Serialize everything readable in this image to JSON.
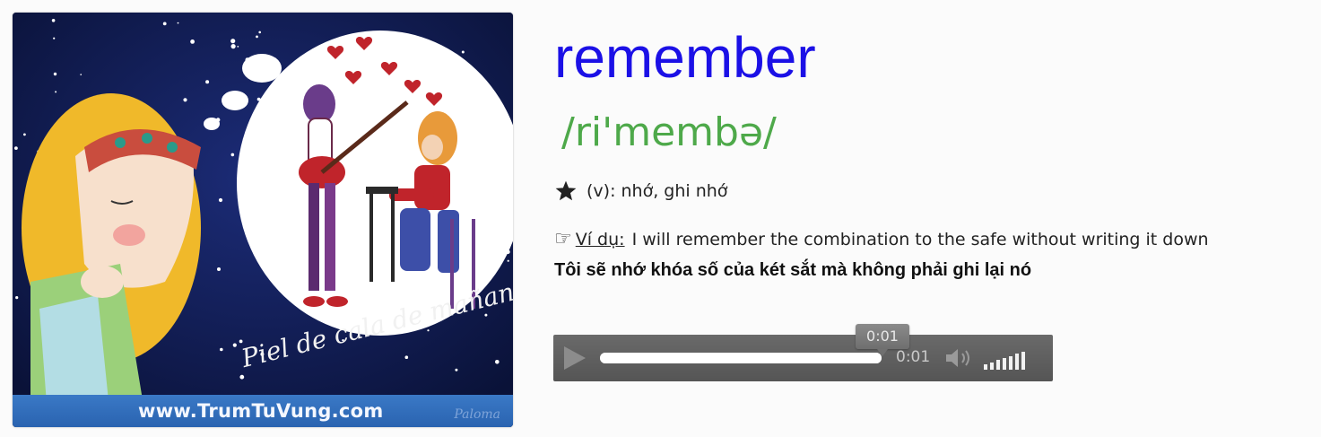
{
  "image": {
    "caption": "www.TrumTuVung.com",
    "painted_title": "Piel de cala de mañana",
    "signature": "Paloma"
  },
  "word": {
    "headword": "remember",
    "phonetic": "/ri'membə/",
    "meaning_icon": "star-icon",
    "meaning": "(v): nhớ, ghi nhớ",
    "example_icon": "pointing-hand-icon",
    "example_label": "Ví dụ:",
    "example_text": "I will remember the combination to the safe without writing it down",
    "translation": "Tôi sẽ nhớ khóa số của két sắt mà không phải ghi lại nó"
  },
  "player": {
    "tooltip_time": "0:01",
    "current_time": "0:01",
    "progress_fraction": 1.0,
    "volume_level": 1.0,
    "volume_bar_count": 7,
    "icons": [
      "play-icon",
      "volume-icon"
    ]
  },
  "colors": {
    "headword": "#1b10e6",
    "phonetic": "#4ea94a",
    "player_bg": "#5f5f5f",
    "caption_bar": "#2f6bb8",
    "sky": "#0f1a4a"
  }
}
